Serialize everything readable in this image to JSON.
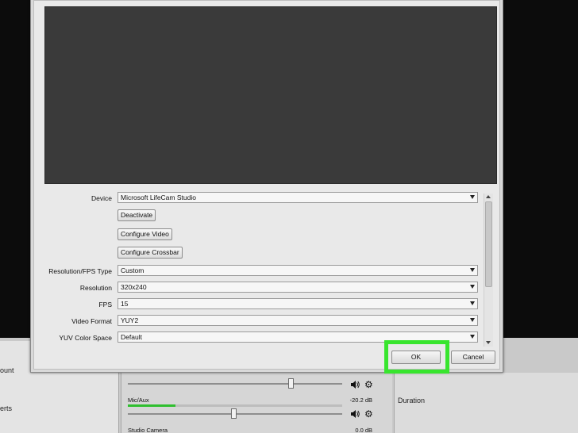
{
  "background": {
    "left_panel_items": [
      "ount",
      "erts"
    ],
    "mixer": [
      {
        "name": "",
        "db": ""
      },
      {
        "name": "Mic/Aux",
        "db": "-20.2 dB"
      },
      {
        "name": "Studio Camera",
        "db": "0.0 dB"
      }
    ],
    "right_panel_label": "Duration"
  },
  "dialog": {
    "properties": [
      {
        "label": "Device",
        "value": "Microsoft LifeCam Studio"
      },
      {
        "label": "Resolution/FPS Type",
        "value": "Custom"
      },
      {
        "label": "Resolution",
        "value": "320x240"
      },
      {
        "label": "FPS",
        "value": "15"
      },
      {
        "label": "Video Format",
        "value": "YUY2"
      },
      {
        "label": "YUV Color Space",
        "value": "Default"
      }
    ],
    "buttons": {
      "deactivate": "Deactivate",
      "configure_video": "Configure Video",
      "configure_crossbar": "Configure Crossbar",
      "ok": "OK",
      "cancel": "Cancel"
    }
  },
  "colors": {
    "highlight": "#38e52e",
    "preview": "#3a3a3a"
  },
  "icons": [
    "speaker-icon",
    "gear-icon",
    "chevron-down-icon",
    "scroll-up-icon",
    "scroll-down-icon"
  ]
}
